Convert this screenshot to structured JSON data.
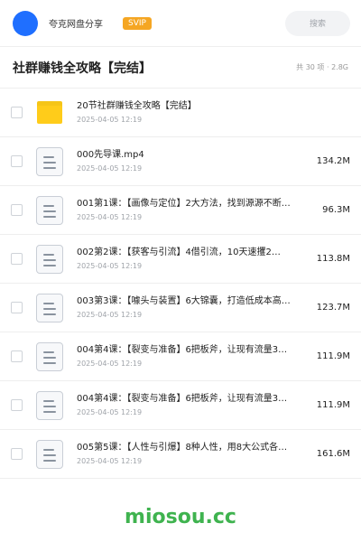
{
  "topbar": {
    "brand": "夸克网盘分享",
    "badge": "SVIP",
    "search_label": "搜索"
  },
  "header": {
    "title": "社群赚钱全攻略【完结】",
    "meta": "共 30 项 · 2.8G"
  },
  "items": [
    {
      "type": "folder",
      "name": "20节社群赚钱全攻略【完结】",
      "date": "2025-04-05 12:19",
      "size": ""
    },
    {
      "type": "file",
      "name": "000先导课.mp4",
      "date": "2025-04-05 12:19",
      "size": "134.2M"
    },
    {
      "type": "file",
      "name": "001第1课：【画像与定位】2大方法，找到源源不断…",
      "date": "2025-04-05 12:19",
      "size": "96.3M"
    },
    {
      "type": "file",
      "name": "002第2课：【获客与引流】4借引流，10天速攫2…",
      "date": "2025-04-05 12:19",
      "size": "113.8M"
    },
    {
      "type": "file",
      "name": "003第3课：【噱头与装置】6大锦囊，打造低成本高…",
      "date": "2025-04-05 12:19",
      "size": "123.7M"
    },
    {
      "type": "file",
      "name": "004第4课：【裂变与准备】6把板斧，让现有流量3…",
      "date": "2025-04-05 12:19",
      "size": "111.9M"
    },
    {
      "type": "file",
      "name": "004第4课：【裂变与准备】6把板斧，让现有流量3…",
      "date": "2025-04-05 12:19",
      "size": "111.9M"
    },
    {
      "type": "file",
      "name": "005第5课：【人性与引爆】8种人性，用8大公式各…",
      "date": "2025-04-05 12:19",
      "size": "161.6M"
    }
  ],
  "watermark": "miosou.cc",
  "colors": {
    "accent": "#1f6fff",
    "badge": "#f5a623",
    "folder": "#ffcc1a",
    "watermark": "#3fb34f"
  }
}
